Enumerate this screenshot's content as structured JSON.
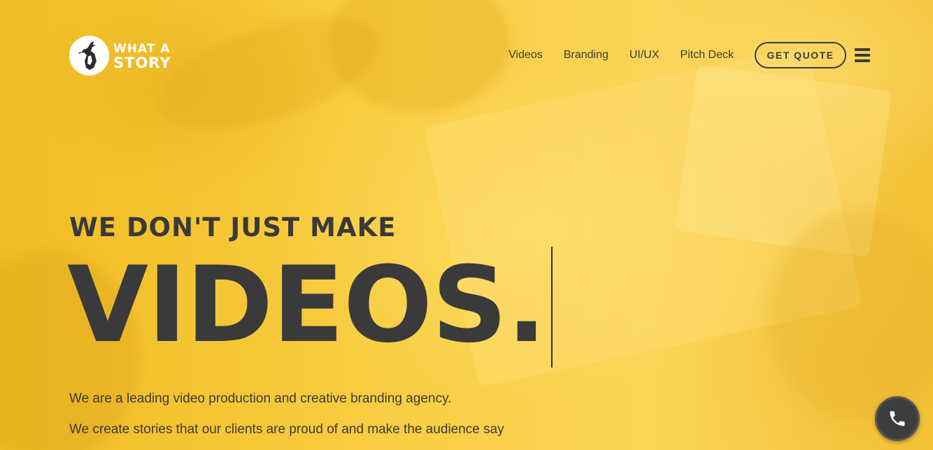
{
  "brand": {
    "logo_line1": "WHAT A",
    "logo_line2": "STORY"
  },
  "nav": {
    "links": [
      {
        "label": "Videos"
      },
      {
        "label": "Branding"
      },
      {
        "label": "UI/UX"
      },
      {
        "label": "Pitch Deck"
      }
    ],
    "cta_label": "GET QUOTE",
    "menu_icon": "hamburger-icon"
  },
  "hero": {
    "tagline": "WE DON'T JUST MAKE",
    "headline": "VIDEOS.",
    "paragraphs": [
      "We are a leading video production and creative branding agency.",
      "We create stories that our clients are proud of and make the audience say"
    ]
  },
  "floating": {
    "call_icon": "phone-icon"
  },
  "colors": {
    "accent": "#f6c631",
    "text": "#3a3a3a",
    "white": "#ffffff"
  }
}
